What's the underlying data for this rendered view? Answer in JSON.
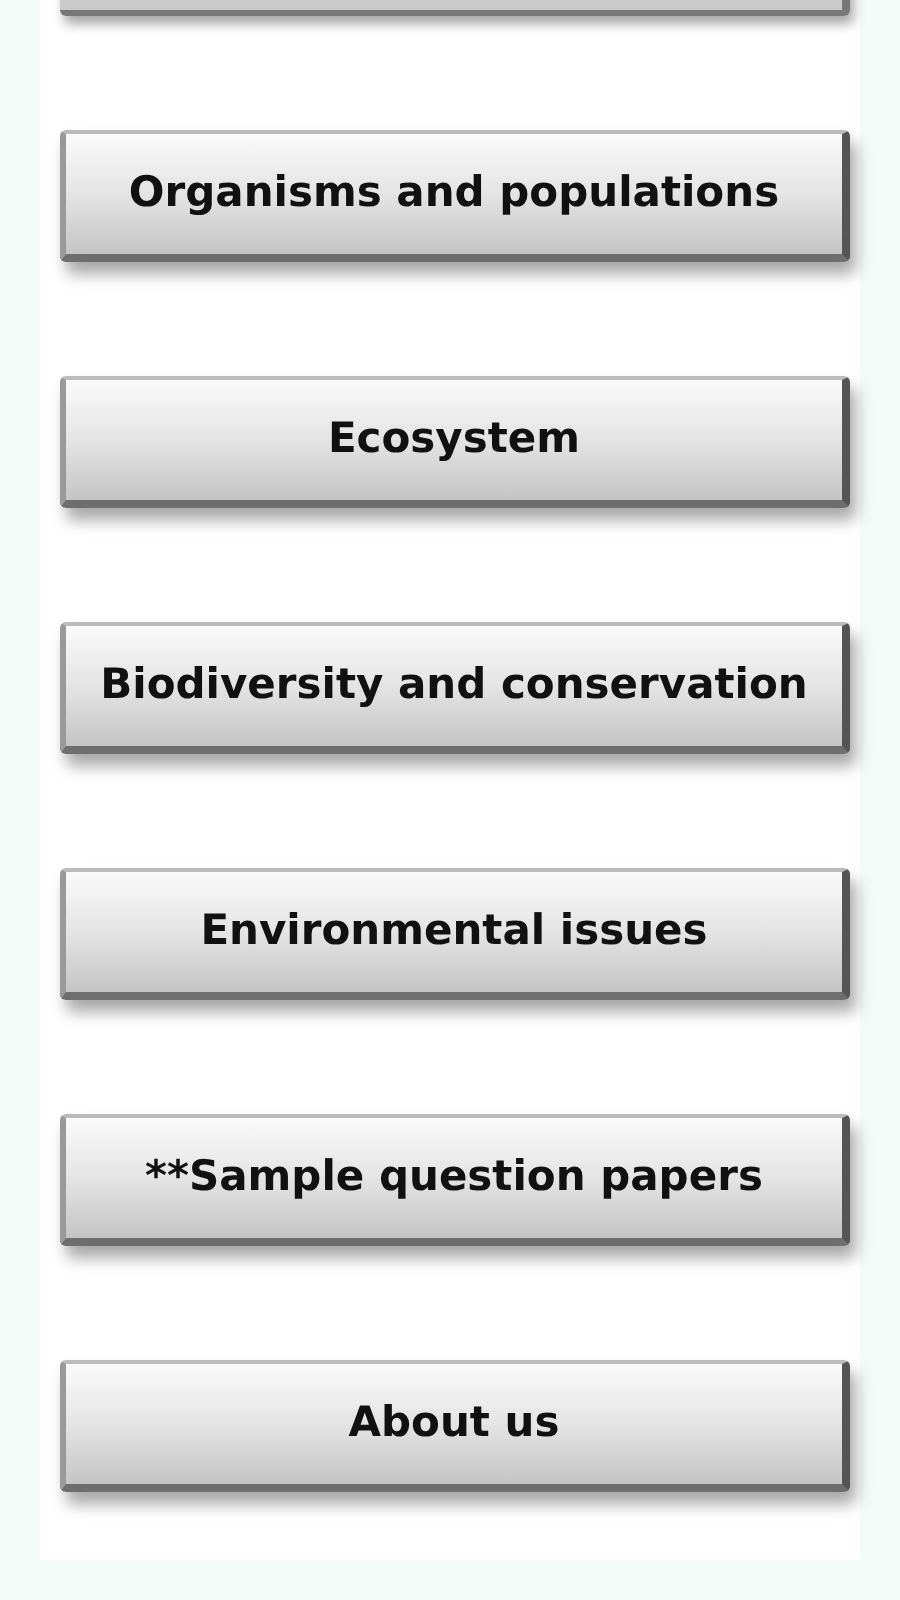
{
  "menu_buttons": [
    {
      "label": "Organisms and populations"
    },
    {
      "label": "Ecosystem"
    },
    {
      "label": "Biodiversity and conservation"
    },
    {
      "label": "Environmental issues"
    },
    {
      "label": "**Sample question papers"
    },
    {
      "label": "About us"
    }
  ]
}
